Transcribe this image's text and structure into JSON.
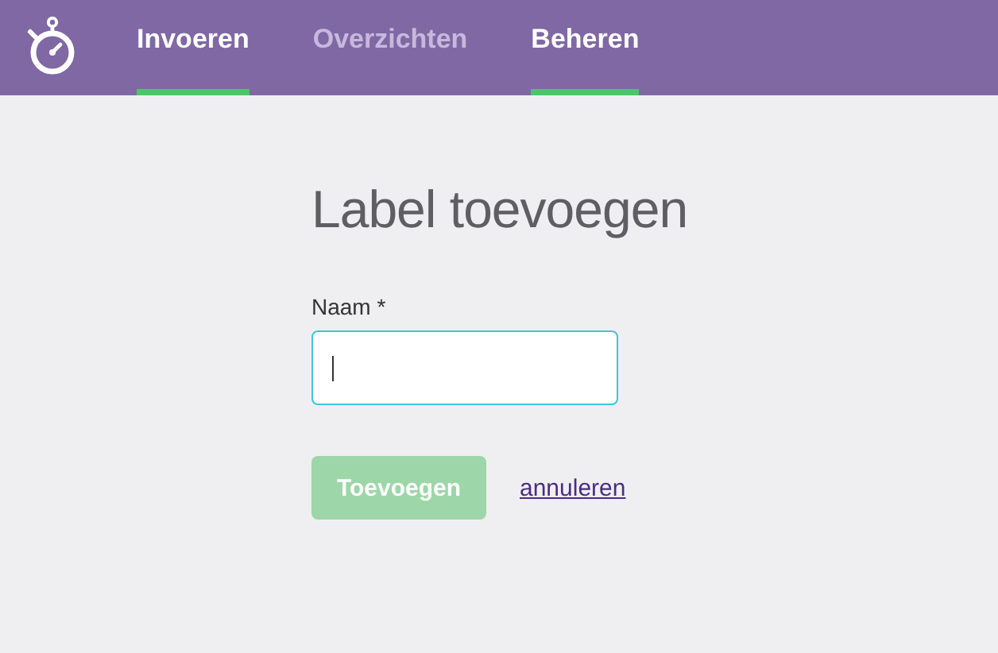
{
  "nav": {
    "tabs": [
      {
        "label": "Invoeren",
        "selected": true,
        "disabled": false
      },
      {
        "label": "Overzichten",
        "selected": false,
        "disabled": true
      },
      {
        "label": "Beheren",
        "selected": true,
        "disabled": false
      }
    ]
  },
  "form": {
    "title": "Label toevoegen",
    "field": {
      "label": "Naam *",
      "focused": true
    },
    "submit": {
      "label": "Toevoegen",
      "disabled": true
    },
    "cancel": {
      "label": "annuleren"
    }
  }
}
